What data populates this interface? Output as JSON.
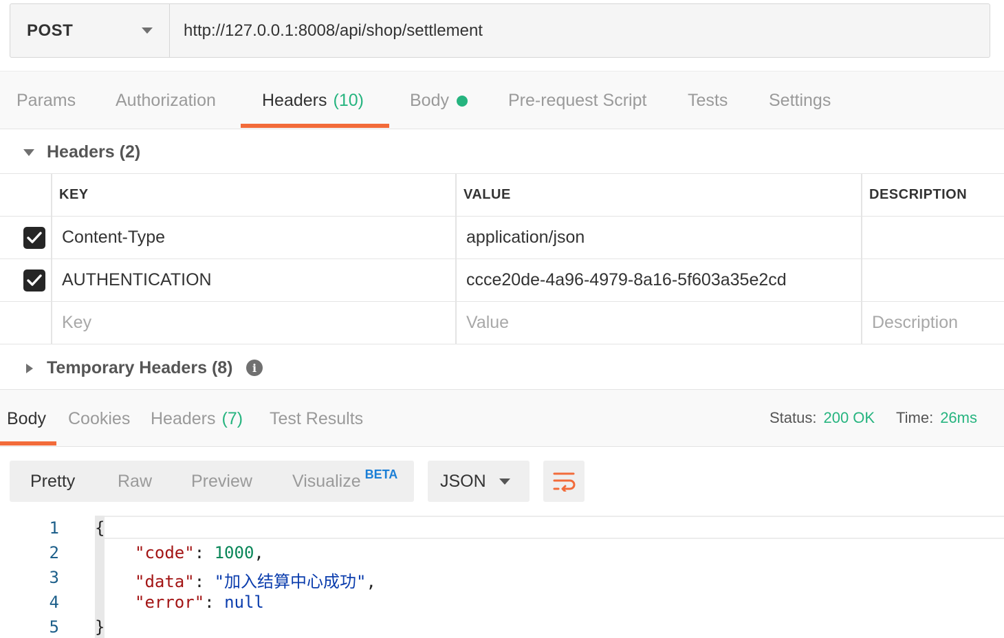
{
  "request": {
    "method": "POST",
    "url": "http://127.0.0.1:8008/api/shop/settlement"
  },
  "request_tabs": [
    {
      "label": "Params"
    },
    {
      "label": "Authorization"
    },
    {
      "label": "Headers",
      "count": "(10)"
    },
    {
      "label": "Body"
    },
    {
      "label": "Pre-request Script"
    },
    {
      "label": "Tests"
    },
    {
      "label": "Settings"
    }
  ],
  "active_request_tab": "Headers",
  "headers_section": {
    "title": "Headers",
    "count": "(2)",
    "columns": {
      "key": "KEY",
      "value": "VALUE",
      "description": "DESCRIPTION"
    },
    "rows": [
      {
        "checked": true,
        "key": "Content-Type",
        "value": "application/json",
        "description": ""
      },
      {
        "checked": true,
        "key": "AUTHENTICATION",
        "value": "ccce20de-4a96-4979-8a16-5f603a35e2cd",
        "description": ""
      }
    ],
    "placeholders": {
      "key": "Key",
      "value": "Value",
      "description": "Description"
    }
  },
  "temporary_headers": {
    "title": "Temporary Headers",
    "count": "(8)"
  },
  "response_tabs": [
    {
      "label": "Body"
    },
    {
      "label": "Cookies"
    },
    {
      "label": "Headers",
      "count": "(7)"
    },
    {
      "label": "Test Results"
    }
  ],
  "active_response_tab": "Body",
  "response_status": {
    "status_label": "Status:",
    "status_value": "200 OK",
    "time_label": "Time:",
    "time_value": "26ms"
  },
  "format_modes": {
    "pretty": "Pretty",
    "raw": "Raw",
    "preview": "Preview",
    "visualize": "Visualize",
    "beta": "BETA"
  },
  "active_format_mode": "Pretty",
  "language": "JSON",
  "code": {
    "line_numbers": [
      "1",
      "2",
      "3",
      "4",
      "5"
    ],
    "open_brace": "{",
    "close_brace": "}",
    "entries": [
      {
        "key": "\"code\"",
        "value": "1000",
        "trail": ","
      },
      {
        "key": "\"data\"",
        "value": "\"加入结算中心成功\"",
        "trail": ","
      },
      {
        "key": "\"error\"",
        "value": "null",
        "trail": ""
      }
    ]
  },
  "colors": {
    "accent": "#f26b3a",
    "success": "#26b47f",
    "beta": "#1b7fd6"
  },
  "icons": {
    "method_dropdown": "chevron-down-icon",
    "section_collapse": "triangle-down-icon",
    "section_expand": "triangle-right-icon",
    "info": "info-icon",
    "checkbox": "checkmark-icon",
    "wrap": "wrap-lines-icon"
  }
}
